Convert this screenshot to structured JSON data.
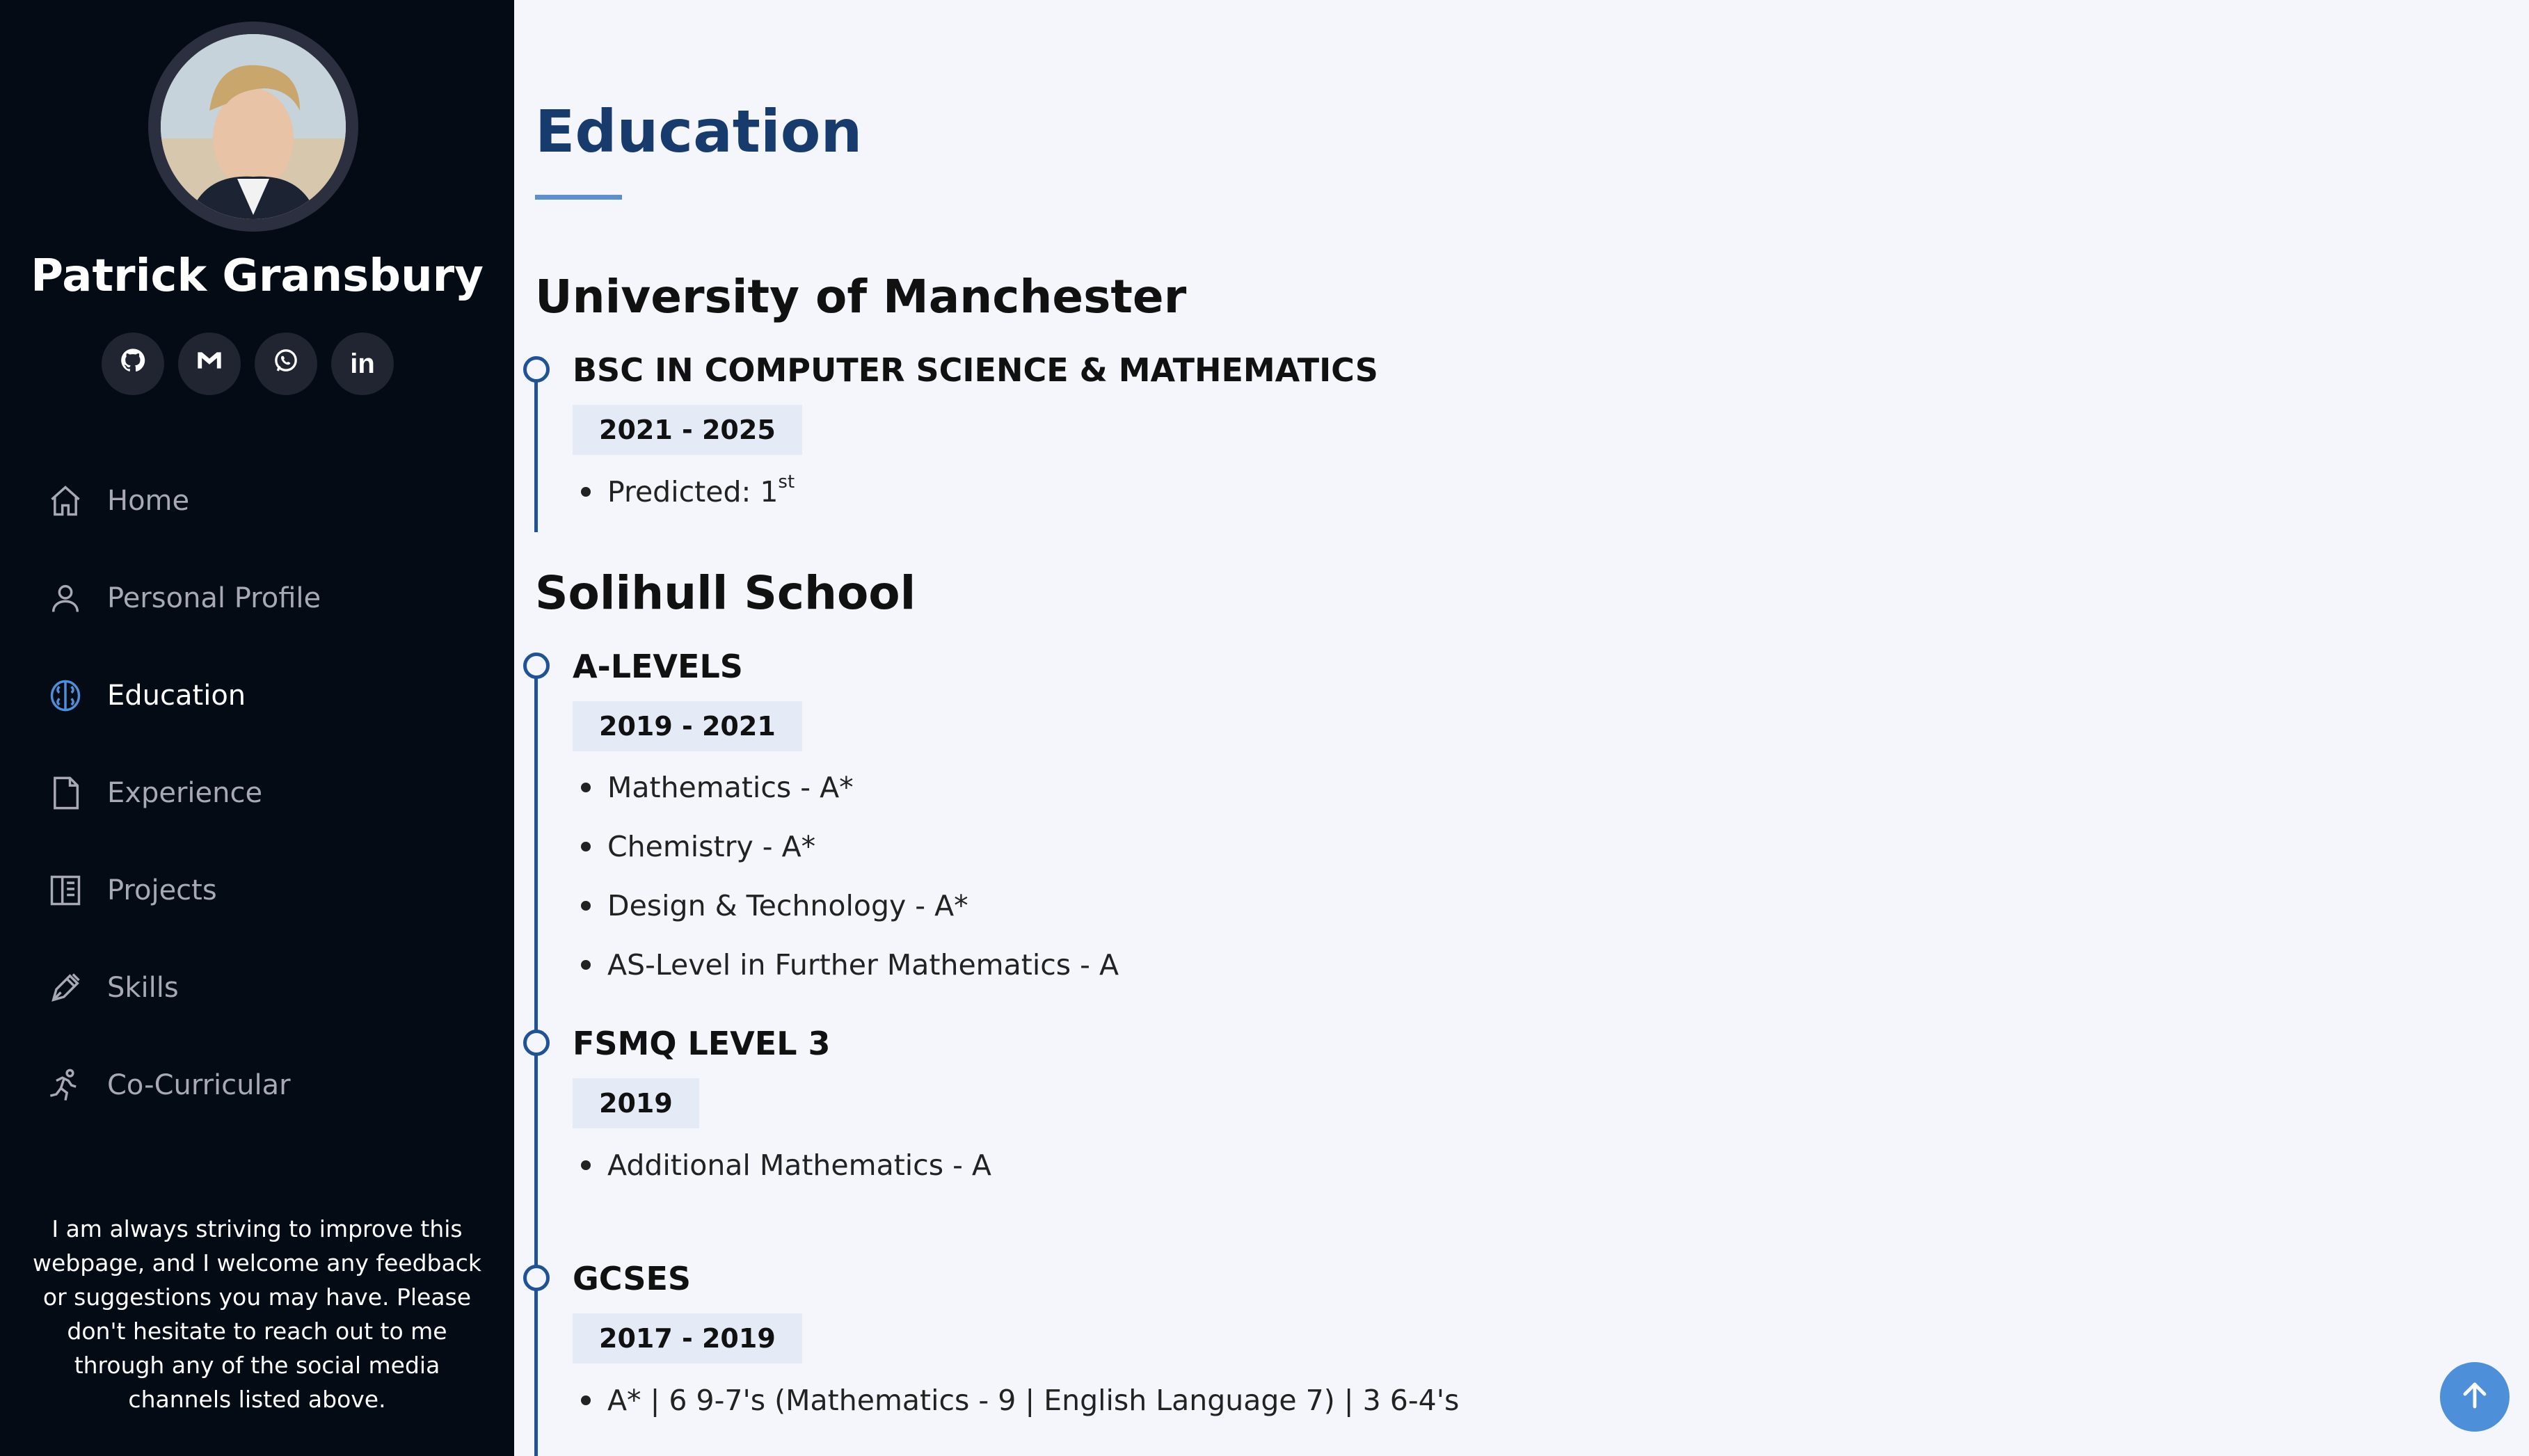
{
  "sidebar": {
    "name": "Patrick Gransbury",
    "socials": [
      {
        "icon": "github-icon"
      },
      {
        "icon": "gmail-icon"
      },
      {
        "icon": "whatsapp-icon"
      },
      {
        "icon": "linkedin-icon",
        "text": "in"
      }
    ],
    "nav": [
      {
        "label": "Home",
        "icon": "house-icon",
        "active": false
      },
      {
        "label": "Personal Profile",
        "icon": "person-icon",
        "active": false
      },
      {
        "label": "Education",
        "icon": "brain-icon",
        "active": true
      },
      {
        "label": "Experience",
        "icon": "document-icon",
        "active": false
      },
      {
        "label": "Projects",
        "icon": "book-icon",
        "active": false
      },
      {
        "label": "Skills",
        "icon": "pen-icon",
        "active": false
      },
      {
        "label": "Co-Curricular",
        "icon": "running-person-icon",
        "active": false
      }
    ],
    "note": "I am always striving to improve this webpage, and I welcome any feedback or suggestions you may have. Please don't hesitate to reach out to me through any of the social media channels listed above."
  },
  "main": {
    "title": "Education",
    "schools": [
      {
        "name": "University of Manchester",
        "qualifications": [
          {
            "title": "BSc in Computer Science & Mathematics",
            "dates": "2021 - 2025",
            "items": [
              {
                "text": "Predicted: 1",
                "sup": "st"
              }
            ]
          }
        ]
      },
      {
        "name": "Solihull School",
        "qualifications": [
          {
            "title": "A-Levels",
            "dates": "2019 - 2021",
            "items": [
              {
                "text": "Mathematics - A*"
              },
              {
                "text": "Chemistry - A*"
              },
              {
                "text": "Design & Technology - A*"
              },
              {
                "text": "AS-Level in Further Mathematics - A"
              }
            ]
          },
          {
            "title": "FSMQ Level 3",
            "dates": "2019",
            "items": [
              {
                "text": "Additional Mathematics - A"
              }
            ]
          },
          {
            "title": "GCSEs",
            "dates": "2017 - 2019",
            "items": [
              {
                "text": "A* | 6 9-7's (Mathematics - 9 | English Language 7) | 3 6-4's"
              }
            ]
          }
        ]
      }
    ]
  },
  "back_to_top": {
    "icon": "arrow-up-icon"
  },
  "colors": {
    "sidebar_bg": "#040b14",
    "page_bg": "#f4f6fb",
    "accent": "#173b6c",
    "timeline": "#1f5297",
    "badge_bg": "#e4ebf7",
    "back_to_top": "#4d8fd8"
  }
}
